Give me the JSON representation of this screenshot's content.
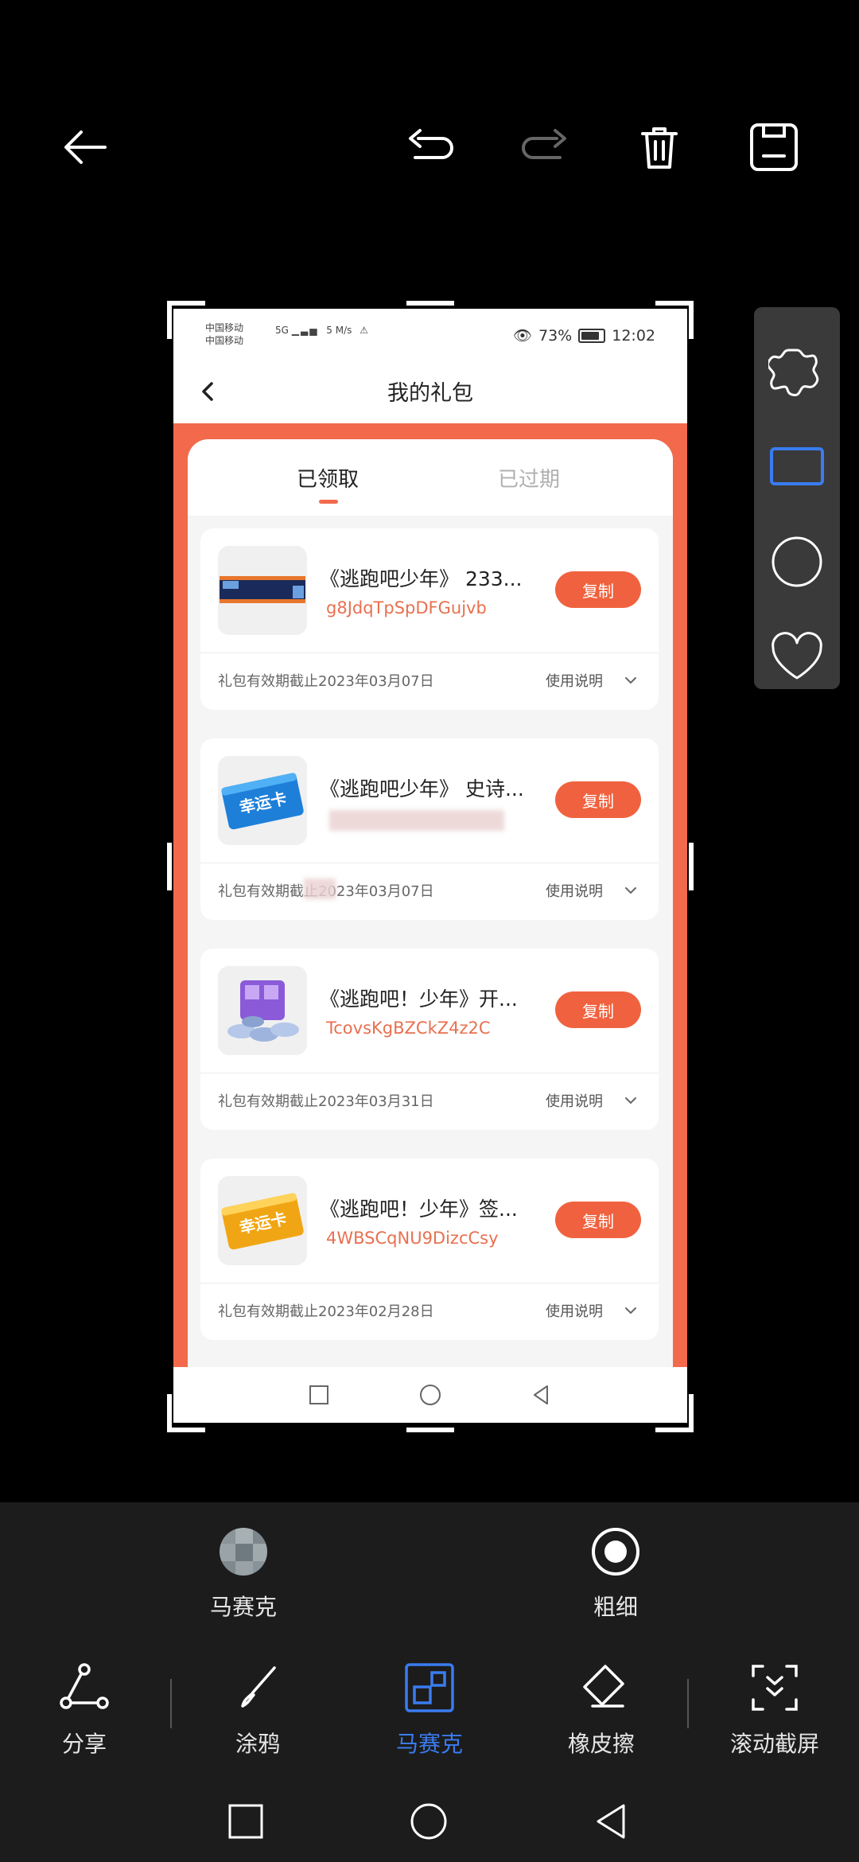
{
  "topbar": {
    "icons": [
      "back-arrow-icon",
      "undo-icon",
      "redo-icon",
      "delete-icon",
      "save-icon"
    ]
  },
  "palette": {
    "shapes": [
      "puzzle-shape-icon",
      "rectangle-shape-icon",
      "circle-shape-icon",
      "heart-shape-icon"
    ],
    "selected_color": "#3a7cf0"
  },
  "screenshot": {
    "status": {
      "carrier1": "中国移动",
      "carrier2": "中国移动",
      "net": "5G",
      "speed": "5 M/s",
      "battery": "73%",
      "time": "12:02"
    },
    "nav": {
      "title": "我的礼包"
    },
    "tabs": {
      "active": "已领取",
      "inactive": "已过期"
    },
    "gifts": [
      {
        "title": "《逃跑吧少年》 233...",
        "code": "g8JdqTpSpDFGujvb",
        "copy": "复制",
        "expiry": "礼包有效期截止2023年03月07日",
        "usage": "使用说明",
        "thumb": "banner"
      },
      {
        "title": "《逃跑吧少年》 史诗...",
        "code": "",
        "copy": "复制",
        "expiry": "礼包有效期截止2023年03月07日",
        "usage": "使用说明",
        "thumb": "blue-card"
      },
      {
        "title": "《逃跑吧！少年》开...",
        "code": "TcovsKgBZCkZ4z2C",
        "copy": "复制",
        "expiry": "礼包有效期截止2023年03月31日",
        "usage": "使用说明",
        "thumb": "coins"
      },
      {
        "title": "《逃跑吧！少年》签...",
        "code": "4WBSCqNU9DizcCsy",
        "copy": "复制",
        "expiry": "礼包有效期截止2023年02月28日",
        "usage": "使用说明",
        "thumb": "gold-card"
      }
    ],
    "thumb_text": {
      "card": "幸运卡"
    },
    "accent": "#f26a4b"
  },
  "options": {
    "mosaic_label": "马赛克",
    "thickness_label": "粗细"
  },
  "tools": [
    {
      "label": "分享",
      "icon": "share-icon"
    },
    {
      "label": "涂鸦",
      "icon": "brush-icon"
    },
    {
      "label": "马赛克",
      "icon": "mosaic-icon",
      "active": true
    },
    {
      "label": "橡皮擦",
      "icon": "eraser-icon"
    },
    {
      "label": "滚动截屏",
      "icon": "scroll-screenshot-icon"
    }
  ]
}
